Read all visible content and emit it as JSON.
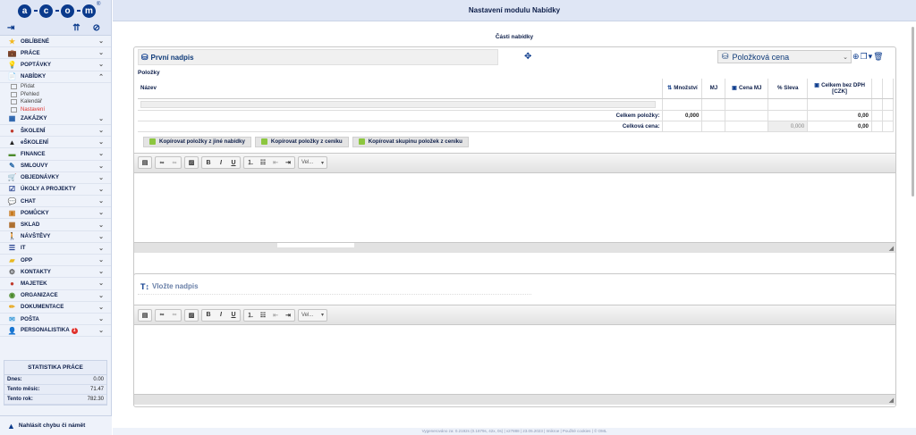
{
  "app": {
    "logo_letters": [
      "a",
      "c",
      "o",
      "m"
    ],
    "page_title": "Nastavení modulu Nabídky",
    "footer": "Vygenerováno za: 0.2192s (0.1879s, 42x, 0s) | v27888 | 23.05.2023 | Imikroe | Použité cookies | © OML"
  },
  "sidebar": {
    "menu": [
      {
        "label": "OBLÍBENÉ",
        "icon": "★",
        "icon_color": "#f2b820",
        "chevron": "⌄"
      },
      {
        "label": "PRÁCE",
        "icon": "💼",
        "icon_color": "#8b4a1e",
        "chevron": "⌄"
      },
      {
        "label": "POPTÁVKY",
        "icon": "💡",
        "icon_color": "#777",
        "chevron": "⌄"
      },
      {
        "label": "NABÍDKY",
        "icon": "📄",
        "icon_color": "#555",
        "chevron": "⌃"
      },
      {
        "label": "ZAKÁZKY",
        "icon": "▦",
        "icon_color": "#1e5aa8",
        "chevron": "⌄"
      },
      {
        "label": "ŠKOLENÍ",
        "icon": "●",
        "icon_color": "#c0392b",
        "chevron": "⌄"
      },
      {
        "label": "eŠKOLENÍ",
        "icon": "▲",
        "icon_color": "#222",
        "chevron": "⌄"
      },
      {
        "label": "FINANCE",
        "icon": "▬",
        "icon_color": "#4a8a2a",
        "chevron": "⌄"
      },
      {
        "label": "SMLOUVY",
        "icon": "✎",
        "icon_color": "#2a6aa8",
        "chevron": "⌄"
      },
      {
        "label": "OBJEDNÁVKY",
        "icon": "🛒",
        "icon_color": "#e08a1e",
        "chevron": "⌄"
      },
      {
        "label": "ÚKOLY A PROJEKTY",
        "icon": "☑",
        "icon_color": "#1e3a8a",
        "chevron": "⌄"
      },
      {
        "label": "CHAT",
        "icon": "💬",
        "icon_color": "#3a9ad8",
        "chevron": "⌄"
      },
      {
        "label": "POMŮCKY",
        "icon": "▣",
        "icon_color": "#c87a1e",
        "chevron": "⌄"
      },
      {
        "label": "SKLAD",
        "icon": "▦",
        "icon_color": "#a8641e",
        "chevron": "⌄"
      },
      {
        "label": "NÁVŠTĚVY",
        "icon": "🚶",
        "icon_color": "#222",
        "chevron": "⌄"
      },
      {
        "label": "IT",
        "icon": "☰",
        "icon_color": "#1e3a8a",
        "chevron": "⌄"
      },
      {
        "label": "OPP",
        "icon": "▰",
        "icon_color": "#e8b81e",
        "chevron": "⌄"
      },
      {
        "label": "KONTAKTY",
        "icon": "⚙",
        "icon_color": "#555",
        "chevron": "⌄"
      },
      {
        "label": "MAJETEK",
        "icon": "●",
        "icon_color": "#c0392b",
        "chevron": "⌄"
      },
      {
        "label": "ORGANIZACE",
        "icon": "◉",
        "icon_color": "#4a8a2a",
        "chevron": "⌄"
      },
      {
        "label": "DOKUMENTACE",
        "icon": "✏",
        "icon_color": "#e8a81e",
        "chevron": "⌄"
      },
      {
        "label": "POŠTA",
        "icon": "✉",
        "icon_color": "#3a9ad8",
        "chevron": "⌄"
      },
      {
        "label": "PERSONALISTIKA",
        "icon": "👤",
        "icon_color": "#8b4a1e",
        "chevron": "⌄",
        "badge": "1"
      }
    ],
    "nabidky_sub": [
      {
        "label": "Přidat"
      },
      {
        "label": "Přehled"
      },
      {
        "label": "Kalendář"
      },
      {
        "label": "Nastavení",
        "active": true
      }
    ],
    "stats": {
      "title": "STATISTIKA PRÁCE",
      "rows": [
        {
          "label": "Dnes:",
          "value": "0.00"
        },
        {
          "label": "Tento měsíc:",
          "value": "71.47"
        },
        {
          "label": "Tento rok:",
          "value": "782.30"
        }
      ]
    },
    "report": "Nahlásit chybu či námět"
  },
  "main": {
    "section_title": "Části nabídky",
    "block1": {
      "title": "První nadpis",
      "price_select": "Položková cena",
      "items_label": "Položky",
      "columns": {
        "name": "Název",
        "qty": "Množství",
        "unit": "MJ",
        "unit_price": "Cena MJ",
        "discount": "% Sleva",
        "total_line1": "Celkem bez DPH",
        "total_line2": "[CZK]"
      },
      "sum_items_label": "Celkem položky:",
      "sum_items_qty": "0,000",
      "sum_items_total": "0,00",
      "total_price_label": "Celková cena:",
      "total_price_discount": "0,000",
      "total_price_total": "0,00",
      "buttons": [
        "Kopírovat položky z jiné nabídky",
        "Kopírovat položky z ceníku",
        "Kopírovat skupinu položek z ceníku"
      ],
      "editor_select": "Vel..."
    },
    "block2": {
      "title": "Vložte nadpis",
      "editor_select": "Vel..."
    }
  }
}
